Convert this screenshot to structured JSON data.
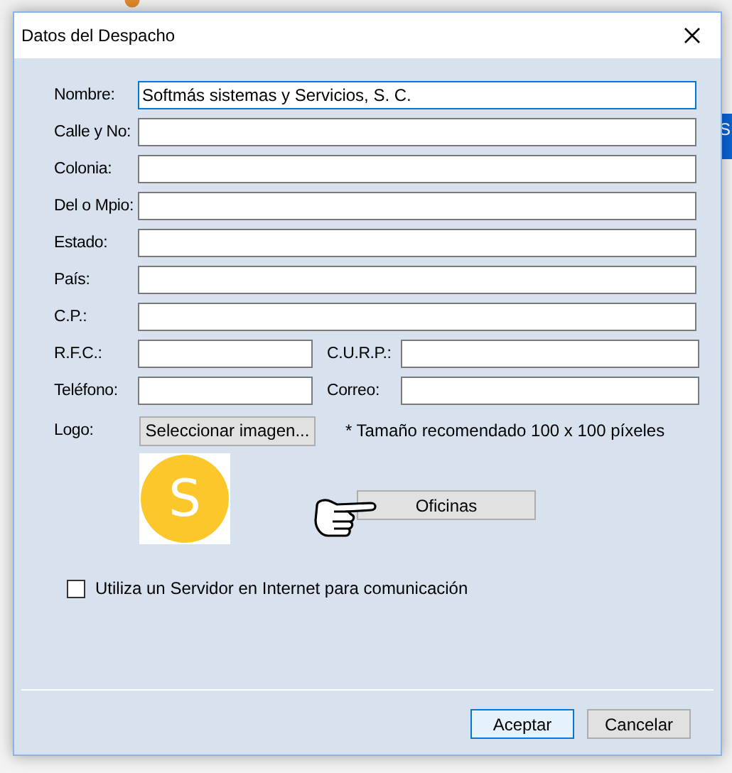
{
  "background_app": {
    "right_tab": "S"
  },
  "dialog": {
    "title": "Datos del Despacho",
    "rows": [
      {
        "kind": "full",
        "fields": [
          {
            "label": "Nombre:",
            "value": "Softmás sistemas y Servicios, S. C.",
            "focused": true
          }
        ]
      },
      {
        "kind": "full",
        "fields": [
          {
            "label": "Calle y No:",
            "focused": false
          }
        ]
      },
      {
        "kind": "full",
        "fields": [
          {
            "label": "Colonia:",
            "focused": false
          }
        ]
      },
      {
        "kind": "full",
        "fields": [
          {
            "label": "Del o Mpio:",
            "focused": false
          }
        ]
      },
      {
        "kind": "full",
        "fields": [
          {
            "label": "Estado:",
            "focused": false
          }
        ]
      },
      {
        "kind": "full",
        "fields": [
          {
            "label": "País:",
            "focused": false
          }
        ]
      },
      {
        "kind": "full",
        "fields": [
          {
            "label": "C.P.:",
            "focused": false
          }
        ]
      },
      {
        "kind": "pair",
        "fields": [
          {
            "label": "R.F.C.:",
            "focused": false
          },
          {
            "label": "C.U.R.P.:",
            "focused": false
          }
        ]
      },
      {
        "kind": "pair",
        "fields": [
          {
            "label": "Teléfono:",
            "focused": false
          },
          {
            "label": "Correo:",
            "focused": false
          }
        ]
      }
    ],
    "logo": {
      "label": "Logo:",
      "button": "Seleccionar imagen...",
      "note": "* Tamaño recomendado 100 x 100 píxeles",
      "letter": "S"
    },
    "offices_button": "Oficinas",
    "checkbox": {
      "label": "Utiliza un Servidor en Internet para comunicación",
      "checked": false
    },
    "buttons": [
      {
        "label": "Aceptar",
        "default": true
      },
      {
        "label": "Cancelar",
        "default": false
      }
    ]
  }
}
